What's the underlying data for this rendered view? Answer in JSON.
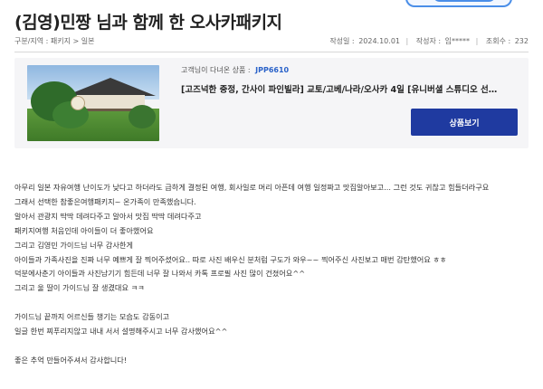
{
  "post": {
    "title": "(김영)민짱 님과 함께 한 오사카패키지",
    "breadcrumb": "구분/지역 : 패키지 > 일본",
    "date_label": "작성일 :",
    "date": "2024.10.01",
    "author_label": "작성자 :",
    "author": "임*****",
    "views_label": "조회수 :",
    "views": "232"
  },
  "product": {
    "visit_prefix": "고객님이 다녀온 상품 :",
    "code": "JPP6610",
    "name": "[고즈넉한 중정, 간사이 파인빌라] 교토/고베/나라/오사카 4일 [유니버셜 스튜디오 선택..",
    "button_label": "상품보기"
  },
  "body": [
    "아무리 일본 자유여행 난이도가 낮다고 하더라도 급하게 결정된 여행, 회사일로 머리 아픈데 여행 일정짜고 맛집알아보고... 그런 것도 귀찮고 힘들더라구요",
    "그래서 선택한 참좋은여행패키지~ 온가족이 만족했습니다.",
    "알아서 관광지 딱딱 데려다주고 알아서 맛집 딱딱 데려다주고",
    "패키지여행 처음인데 아이들이 더 좋아했어요",
    "그리고 김영민 가이드님 너무 감사한게",
    "아이들과 가족사진을 진짜 너무 예쁘게 잘 찍어주셨어요.. 따로 사진 배우신 분처럼 구도가 와우~~ 찍어주신 사진보고 매번 감탄했어요 ㅎㅎ",
    "덕분에사춘기 아이들과 사진남기기 힘든데 너무 잘 나와서 카톡 프로필 사진 많이 건졌어요^^",
    "그리고 울 딸이 가이드님 잘 생겼대요 ㅋㅋ",
    "",
    "가이드님 끝까지 어르신들 챙기는 모습도 감동이고",
    "일글 한번 찌푸리지않고 내내 서서 설명해주시고 너무 감사했어요^^",
    "",
    "좋은 추억 만들어주셔서 감사합니다!"
  ]
}
